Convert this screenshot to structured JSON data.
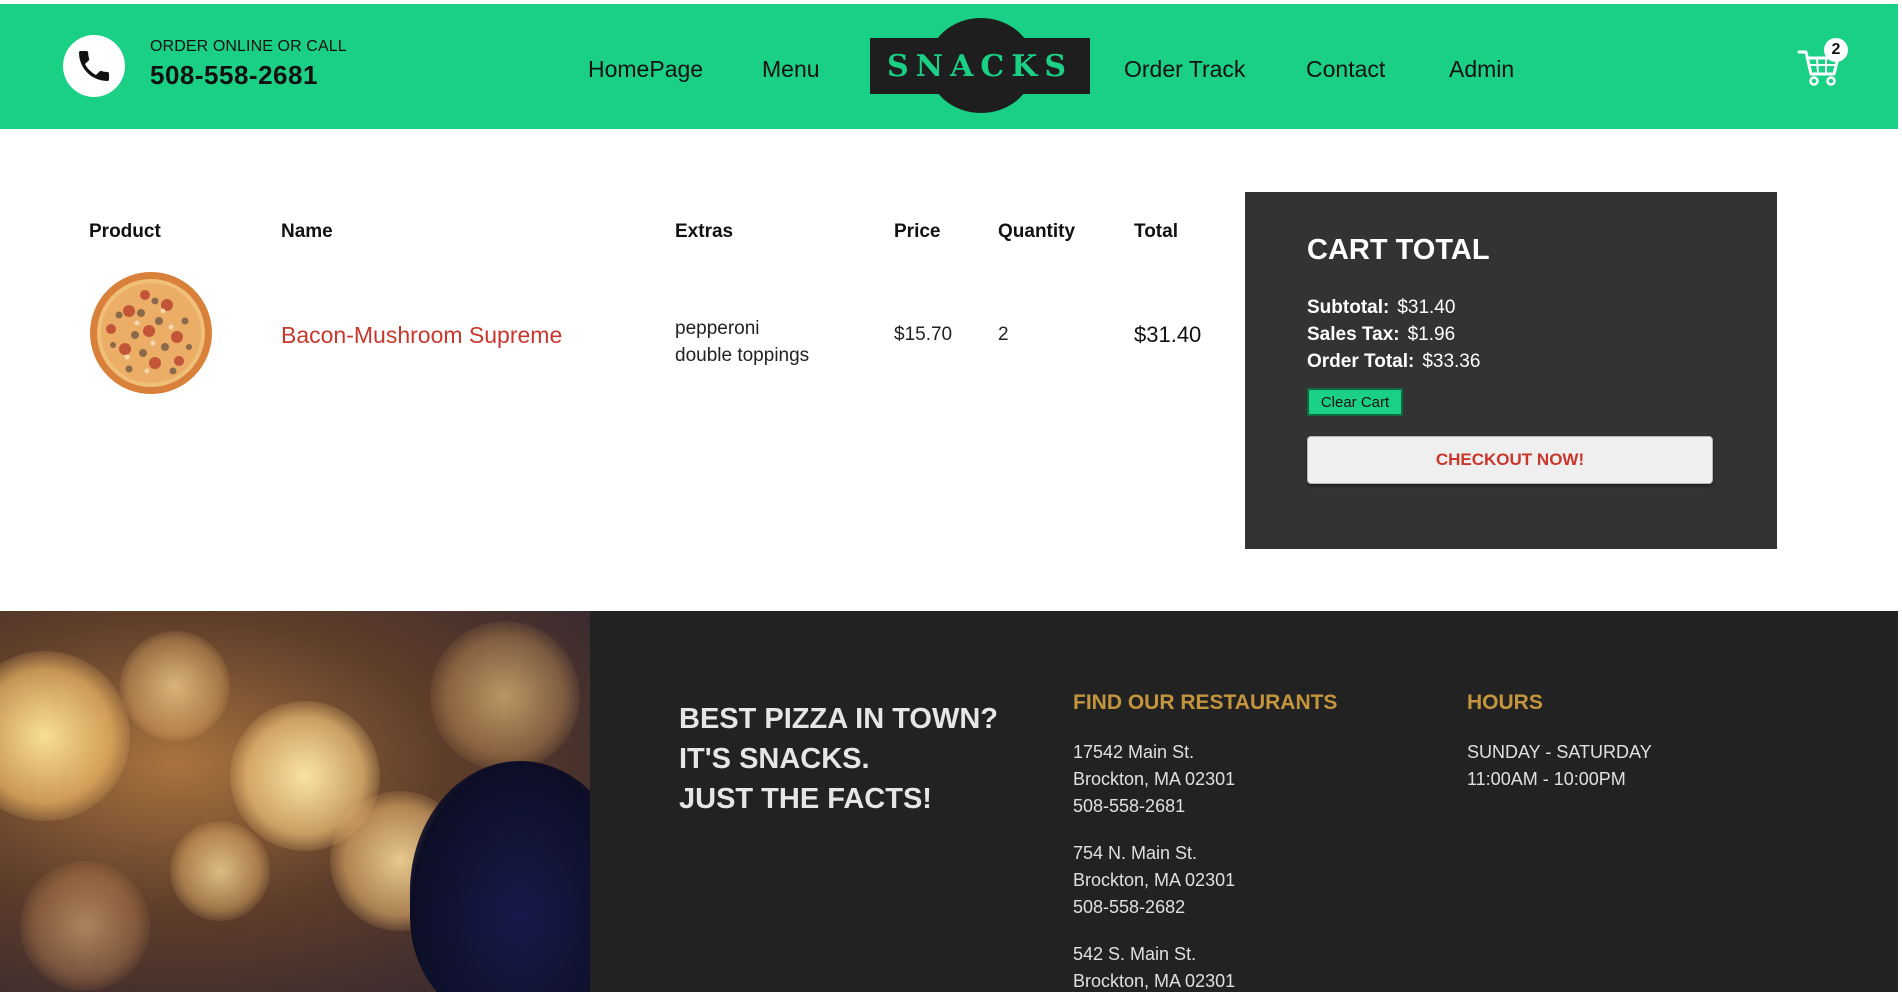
{
  "header": {
    "order_label": "ORDER ONLINE OR CALL",
    "phone": "508-558-2681",
    "nav": [
      "HomePage",
      "Menu",
      "Order Track",
      "Contact",
      "Admin"
    ],
    "logo_text": "SNACKS",
    "cart_count": "2",
    "brand_color": "#1ad085"
  },
  "cart": {
    "headers": [
      "Product",
      "Name",
      "Extras",
      "Price",
      "Quantity",
      "Total"
    ],
    "items": [
      {
        "name": "Bacon-Mushroom Supreme",
        "extras": [
          "pepperoni",
          "double toppings"
        ],
        "price": "$15.70",
        "quantity": "2",
        "total": "$31.40"
      }
    ]
  },
  "summary": {
    "title": "CART TOTAL",
    "subtotal_label": "Subtotal:",
    "subtotal": "$31.40",
    "tax_label": "Sales Tax:",
    "tax": "$1.96",
    "order_total_label": "Order Total:",
    "order_total": "$33.36",
    "clear_label": "Clear Cart",
    "checkout_label": "CHECKOUT NOW!"
  },
  "footer": {
    "slogan": [
      "BEST PIZZA IN TOWN?",
      "IT'S SNACKS.",
      "JUST THE FACTS!"
    ],
    "restaurants_heading": "FIND OUR RESTAURANTS",
    "restaurants": [
      [
        "17542 Main St.",
        "Brockton, MA 02301",
        "508-558-2681"
      ],
      [
        "754 N. Main St.",
        "Brockton, MA 02301",
        "508-558-2682"
      ],
      [
        "542 S. Main St.",
        "Brockton, MA 02301"
      ]
    ],
    "hours_heading": "HOURS",
    "hours": [
      "SUNDAY - SATURDAY",
      "11:00AM - 10:00PM"
    ]
  }
}
